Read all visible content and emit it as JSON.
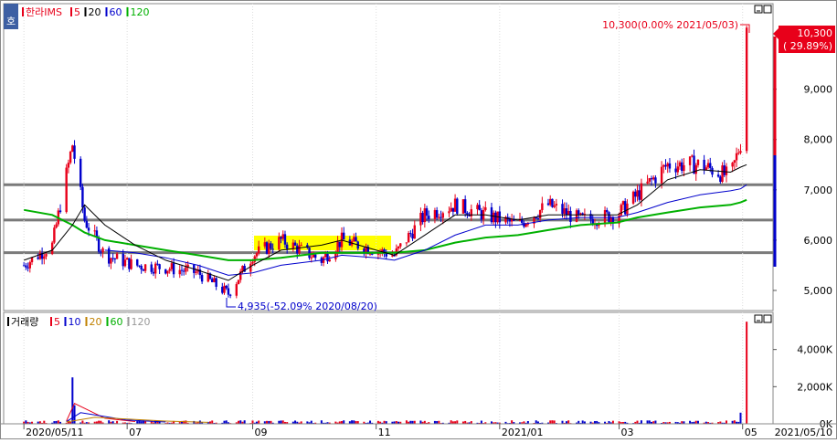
{
  "price_panel": {
    "side_button": "호",
    "legend": [
      {
        "label": "한라IMS",
        "color": "#e8001a"
      },
      {
        "label": "5",
        "color": "#e8001a"
      },
      {
        "label": "20",
        "color": "#000000"
      },
      {
        "label": "60",
        "color": "#0000cc"
      },
      {
        "label": "120",
        "color": "#00b000"
      }
    ],
    "high_annotation": "10,300(0.00% 2021/05/03)",
    "low_annotation": "4,935(-52.09% 2020/08/20)",
    "last_price": "10,300",
    "change_pct": "( 29.89%)"
  },
  "volume_panel": {
    "legend": [
      {
        "label": "거래량",
        "color": "#000000"
      },
      {
        "label": "5",
        "color": "#e8001a"
      },
      {
        "label": "10",
        "color": "#0000cc"
      },
      {
        "label": "20",
        "color": "#c08000"
      },
      {
        "label": "60",
        "color": "#00b000"
      },
      {
        "label": "120",
        "color": "#999999"
      }
    ]
  },
  "x_axis": {
    "labels": [
      "2020/05/11",
      "07",
      "09",
      "11",
      "2021/01",
      "03",
      "05"
    ],
    "end_label": "2021/05/10"
  },
  "colors": {
    "up": "#e8001a",
    "down": "#0000cc",
    "ma5": "#e8001a",
    "ma20": "#000000",
    "ma60": "#0000cc",
    "ma120": "#00b000",
    "hline": "#7a7a7a",
    "highlight": "#ffff00"
  },
  "chart_data": [
    {
      "type": "candlestick",
      "title": "한라IMS",
      "y_ticks": [
        5000,
        6000,
        7000,
        8000,
        9000
      ],
      "y_tick_labels": [
        "5,000",
        "6,000",
        "7,000",
        "8,000",
        "9,000"
      ],
      "ylim": [
        4600,
        10700
      ],
      "series_points": [
        {
          "date": "2020/05/11",
          "close": 5500
        },
        {
          "date": "2020/05/25",
          "close": 5900
        },
        {
          "date": "2020/06/04",
          "close": 7900
        },
        {
          "date": "2020/06/10",
          "close": 6400
        },
        {
          "date": "2020/06/20",
          "close": 5700
        },
        {
          "date": "2020/07/05",
          "close": 5500
        },
        {
          "date": "2020/07/20",
          "close": 5450
        },
        {
          "date": "2020/08/05",
          "close": 5350
        },
        {
          "date": "2020/08/20",
          "close": 4935
        },
        {
          "date": "2020/09/01",
          "close": 5700
        },
        {
          "date": "2020/09/15",
          "close": 6000
        },
        {
          "date": "2020/10/05",
          "close": 5600
        },
        {
          "date": "2020/10/15",
          "close": 6000
        },
        {
          "date": "2020/11/01",
          "close": 5800
        },
        {
          "date": "2020/11/10",
          "close": 5700
        },
        {
          "date": "2020/11/25",
          "close": 6500
        },
        {
          "date": "2020/12/10",
          "close": 6700
        },
        {
          "date": "2020/12/25",
          "close": 6500
        },
        {
          "date": "2021/01/10",
          "close": 6300
        },
        {
          "date": "2021/01/25",
          "close": 6700
        },
        {
          "date": "2021/02/10",
          "close": 6400
        },
        {
          "date": "2021/02/28",
          "close": 6500
        },
        {
          "date": "2021/03/10",
          "close": 6900
        },
        {
          "date": "2021/03/25",
          "close": 7500
        },
        {
          "date": "2021/04/10",
          "close": 7500
        },
        {
          "date": "2021/04/25",
          "close": 7250
        },
        {
          "date": "2021/04/30",
          "close": 7930
        },
        {
          "date": "2021/05/03",
          "close": 10300
        }
      ],
      "ma20": [
        5600,
        5800,
        6300,
        6700,
        6300,
        5900,
        5600,
        5400,
        5200,
        5500,
        5800,
        5900,
        6000,
        5800,
        5700,
        6100,
        6500,
        6500,
        6400,
        6500,
        6500,
        6500,
        6700,
        7200,
        7400,
        7350,
        7450,
        7500
      ],
      "ma60": [
        null,
        null,
        null,
        null,
        5800,
        5750,
        5650,
        5500,
        5300,
        5350,
        5500,
        5600,
        5700,
        5650,
        5600,
        5800,
        6100,
        6300,
        6300,
        6400,
        6450,
        6450,
        6550,
        6750,
        6900,
        6980,
        7020,
        7100
      ],
      "ma120": [
        6600,
        6500,
        6300,
        6150,
        6000,
        5900,
        5800,
        5700,
        5600,
        5600,
        5650,
        5750,
        5750,
        5750,
        5750,
        5800,
        5950,
        6050,
        6100,
        6200,
        6300,
        6350,
        6450,
        6550,
        6650,
        6700,
        6750,
        6800
      ],
      "horizontal_lines": [
        7100,
        6400,
        5750
      ]
    },
    {
      "type": "bar",
      "title": "거래량",
      "y_ticks": [
        0,
        2000000,
        4000000
      ],
      "y_tick_labels": [
        "0K",
        "2,000K",
        "4,000K"
      ],
      "ylim": [
        0,
        6000000
      ],
      "peaks": [
        {
          "date": "2020/06/04",
          "value": 2500000
        },
        {
          "date": "2020/06/05",
          "value": 1000000
        },
        {
          "date": "2021/04/30",
          "value": 600000
        },
        {
          "date": "2021/05/03",
          "value": 5500000
        }
      ]
    }
  ]
}
